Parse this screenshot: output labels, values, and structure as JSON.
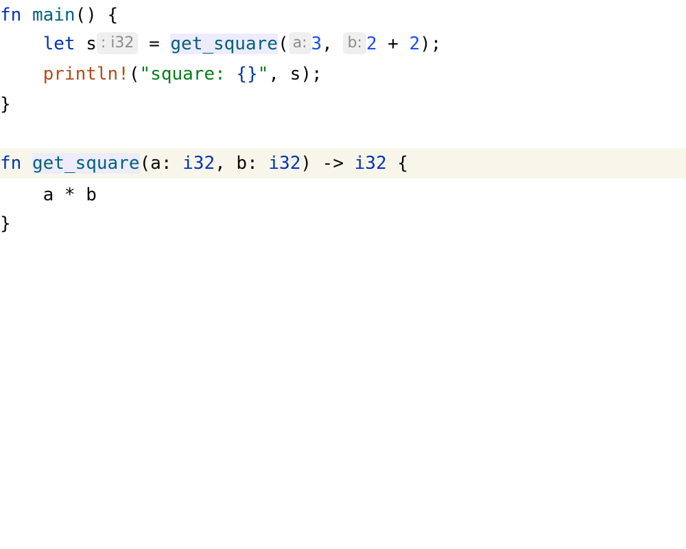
{
  "editor": {
    "lines": {
      "l1": {
        "kw": "fn",
        "sp": " ",
        "name": "main",
        "rest": "() {"
      },
      "l2": {
        "indent": "    ",
        "kw": "let",
        "var": " s",
        "type_hint": ": i32",
        "assign": " = ",
        "call": "get_square",
        "open": "(",
        "hint_a": "a:",
        "arg_a": "3",
        "comma": ", ",
        "hint_b": "b:",
        "arg_b_1": "2",
        "plus": " + ",
        "arg_b_2": "2",
        "close": ");"
      },
      "l3": {
        "indent": "    ",
        "macro": "println!",
        "open": "(",
        "str_a": "\"square: ",
        "fmt": "{}",
        "str_b": "\"",
        "rest": ", s);"
      },
      "l4": {
        "text": "}"
      },
      "l6": {
        "kw": "fn",
        "sp": " ",
        "name": "get_square",
        "p1": "(a: ",
        "t1": "i32",
        "p2": ", b: ",
        "t2": "i32",
        "p3": ") -> ",
        "t3": "i32",
        "p4": " {"
      },
      "l7": {
        "indent": "    ",
        "text": "a * b"
      },
      "l8": {
        "text": "}"
      }
    },
    "colors": {
      "keyword": "#0033b3",
      "function": "#00627a",
      "macro": "#b84a16",
      "string": "#067d17",
      "number": "#1750eb",
      "current_line": "#f8f6ea",
      "usage_highlight": "#edebfc",
      "inlay_hint_bg": "#efefef",
      "inlay_hint_text": "#8c8c8c"
    }
  }
}
